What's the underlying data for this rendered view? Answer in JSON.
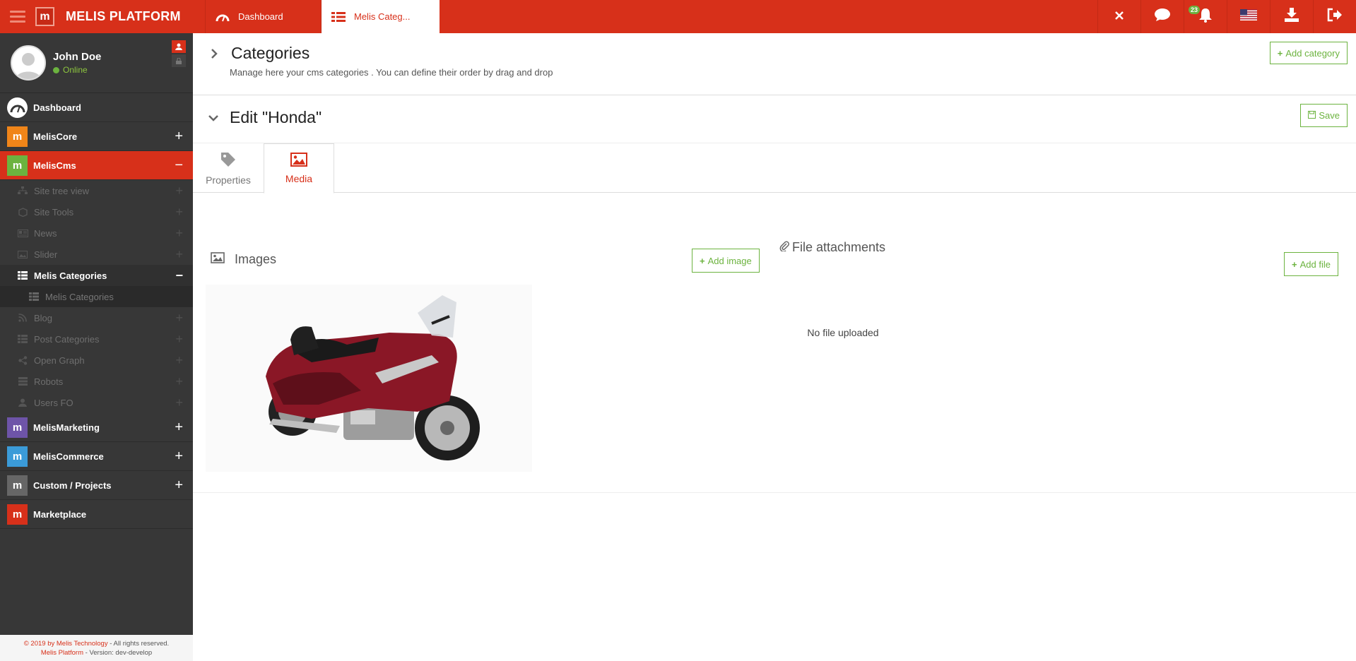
{
  "topbar": {
    "brand": "MELIS PLATFORM",
    "tabs": [
      {
        "label": "Dashboard",
        "icon": "dashboard-icon"
      },
      {
        "label": "Melis Categ...",
        "icon": "list-icon"
      }
    ],
    "notifications_count": "23",
    "colors": {
      "primary": "#d7301a",
      "accent": "#6cb33f"
    }
  },
  "sidebar": {
    "user": {
      "name": "John Doe",
      "status": "Online"
    },
    "items": [
      {
        "label": "Dashboard"
      },
      {
        "label": "MelisCore"
      },
      {
        "label": "MelisCms"
      },
      {
        "label": "MelisMarketing"
      },
      {
        "label": "MelisCommerce"
      },
      {
        "label": "Custom / Projects"
      },
      {
        "label": "Marketplace"
      }
    ],
    "cms_subitems": [
      {
        "label": "Site tree view"
      },
      {
        "label": "Site Tools"
      },
      {
        "label": "News"
      },
      {
        "label": "Slider"
      },
      {
        "label": "Melis Categories"
      },
      {
        "label": "Melis Categories"
      },
      {
        "label": "Blog"
      },
      {
        "label": "Post Categories"
      },
      {
        "label": "Open Graph"
      },
      {
        "label": "Robots"
      },
      {
        "label": "Users FO"
      }
    ],
    "footer": {
      "copyright": "© 2019 by Melis Technology",
      "rights": " - All rights reserved.",
      "platform": "Melis Platform",
      "version": " - Version: dev-develop"
    }
  },
  "main": {
    "title": "Categories",
    "subtitle": "Manage here your cms categories . You can define their order by drag and drop",
    "add_category_label": "Add category",
    "edit_title": "Edit \"Honda\"",
    "save_label": "Save",
    "tabs": [
      {
        "label": "Properties"
      },
      {
        "label": "Media"
      }
    ],
    "images_title": "Images",
    "add_image_label": "Add image",
    "files_title": "File attachments",
    "add_file_label": "Add file",
    "no_file_text": "No file uploaded"
  }
}
